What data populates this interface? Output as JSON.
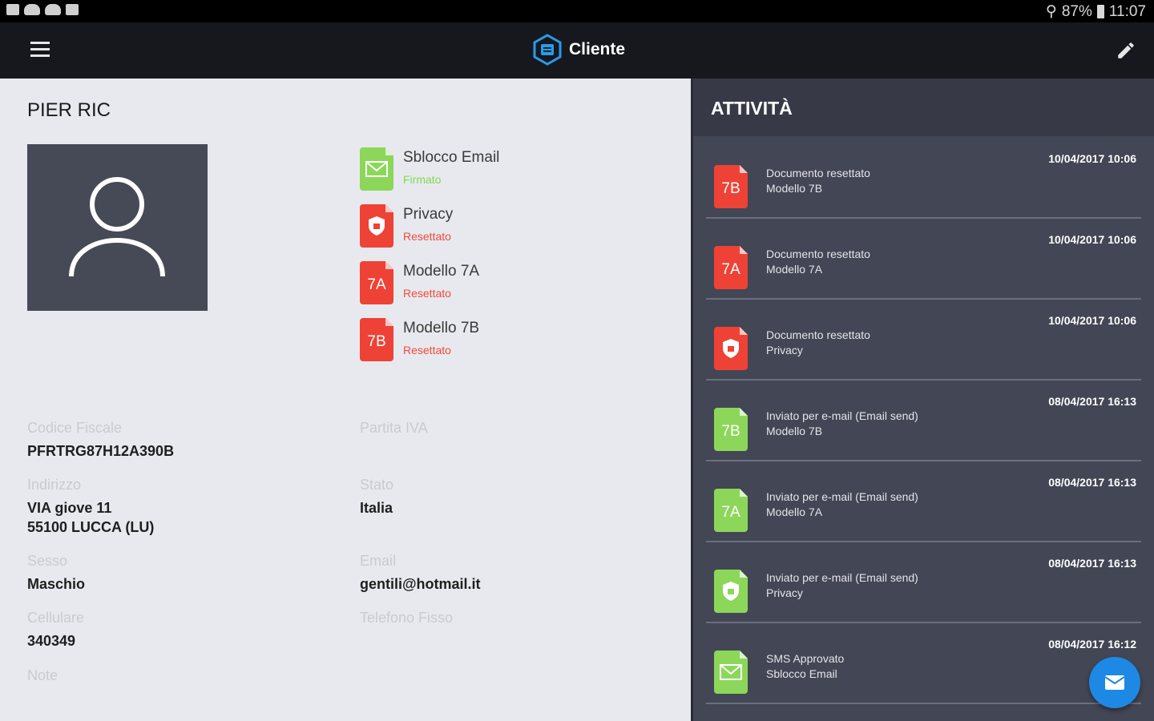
{
  "statusbar": {
    "battery": "87%",
    "time": "11:07"
  },
  "toolbar": {
    "title": "Cliente"
  },
  "client": {
    "name": "PIER RIC"
  },
  "documents": [
    {
      "title": "Sblocco Email",
      "status": "Firmato",
      "status_color": "#7ed957",
      "icon": "email-doc-icon",
      "icon_color": "#8cd75a"
    },
    {
      "title": "Privacy",
      "status": "Resettato",
      "status_color": "#f04a3c",
      "icon": "shield-doc-icon",
      "icon_color": "#ee4236"
    },
    {
      "title": "Modello 7A",
      "status": "Resettato",
      "status_color": "#f04a3c",
      "icon": "7a-doc-icon",
      "icon_color": "#ee4236"
    },
    {
      "title": "Modello 7B",
      "status": "Resettato",
      "status_color": "#f04a3c",
      "icon": "7b-doc-icon",
      "icon_color": "#ee4236"
    }
  ],
  "fields": {
    "codice_fiscale": {
      "label": "Codice Fiscale",
      "value": "PFRTRG87H12A390B"
    },
    "partita_iva": {
      "label": "Partita IVA",
      "value": ""
    },
    "indirizzo": {
      "label": "Indirizzo",
      "value": "VIA giove 11\n55100 LUCCA (LU)"
    },
    "stato": {
      "label": "Stato",
      "value": "Italia"
    },
    "sesso": {
      "label": "Sesso",
      "value": "Maschio"
    },
    "email": {
      "label": "Email",
      "value": "gentili@hotmail.it"
    },
    "cellulare": {
      "label": "Cellulare",
      "value": "340349"
    },
    "telefono_fisso": {
      "label": "Telefono Fisso",
      "value": ""
    },
    "note": {
      "label": "Note",
      "value": ""
    }
  },
  "activity": {
    "header": "ATTIVITÀ",
    "items": [
      {
        "line1": "Documento resettato",
        "line2": "Modello 7B",
        "date": "10/04/2017 10:06",
        "badge": "7B",
        "icon": "7b-doc-icon",
        "color": "#ee4236"
      },
      {
        "line1": "Documento resettato",
        "line2": "Modello 7A",
        "date": "10/04/2017 10:06",
        "badge": "7A",
        "icon": "7a-doc-icon",
        "color": "#ee4236"
      },
      {
        "line1": "Documento resettato",
        "line2": "Privacy",
        "date": "10/04/2017 10:06",
        "badge": "",
        "icon": "shield-doc-icon",
        "color": "#ee4236"
      },
      {
        "line1": "Inviato per e-mail (Email send)",
        "line2": "Modello 7B",
        "date": "08/04/2017 16:13",
        "badge": "7B",
        "icon": "7b-doc-icon",
        "color": "#8cd75a"
      },
      {
        "line1": "Inviato per e-mail (Email send)",
        "line2": "Modello 7A",
        "date": "08/04/2017 16:13",
        "badge": "7A",
        "icon": "7a-doc-icon",
        "color": "#8cd75a"
      },
      {
        "line1": "Inviato per e-mail (Email send)",
        "line2": "Privacy",
        "date": "08/04/2017 16:13",
        "badge": "",
        "icon": "shield-doc-icon",
        "color": "#8cd75a"
      },
      {
        "line1": "SMS Approvato",
        "line2": "Sblocco Email",
        "date": "08/04/2017 16:12",
        "badge": "",
        "icon": "email-doc-icon",
        "color": "#8cd75a"
      }
    ]
  },
  "colors": {
    "accent_blue": "#1e88e5",
    "toolbar": "#16181d",
    "panel_dark": "#434654"
  }
}
